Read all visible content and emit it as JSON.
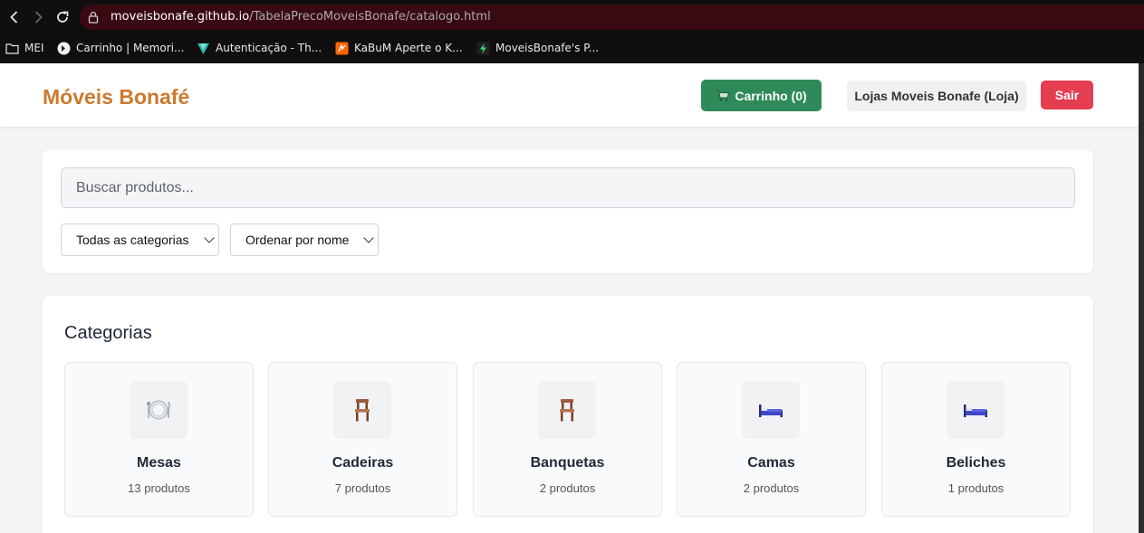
{
  "browser": {
    "url_host": "moveisbonafe.github.io",
    "url_path": "/TabelaPrecoMoveisBonafe/catalogo.html",
    "bookmarks": [
      {
        "label": "MEI",
        "icon": "folder-icon"
      },
      {
        "label": "Carrinho | Memori...",
        "icon": "site-favicon"
      },
      {
        "label": "Autenticação - Th...",
        "icon": "vuetify-favicon"
      },
      {
        "label": "KaBuM Aperte o K...",
        "icon": "kabum-favicon"
      },
      {
        "label": "MoveisBonafe's P...",
        "icon": "bolt-favicon"
      }
    ]
  },
  "header": {
    "logo": "Móveis Bonafé",
    "cart_label": "Carrinho (0)",
    "store_label": "Lojas Moveis Bonafe (Loja)",
    "exit_label": "Sair"
  },
  "filters": {
    "search_placeholder": "Buscar produtos...",
    "category_select": "Todas as categorias",
    "sort_select": "Ordenar por nome"
  },
  "categories": {
    "title": "Categorias",
    "items": [
      {
        "name": "Mesas",
        "count": "13 produtos",
        "icon": "plate-icon"
      },
      {
        "name": "Cadeiras",
        "count": "7 produtos",
        "icon": "chair-icon"
      },
      {
        "name": "Banquetas",
        "count": "2 produtos",
        "icon": "chair-icon"
      },
      {
        "name": "Camas",
        "count": "2 produtos",
        "icon": "bed-icon"
      },
      {
        "name": "Beliches",
        "count": "1 produtos",
        "icon": "bed-icon"
      }
    ]
  },
  "colors": {
    "brand": "#cc7a2e",
    "cart_button": "#2f8a59",
    "exit_button": "#e43e50"
  }
}
